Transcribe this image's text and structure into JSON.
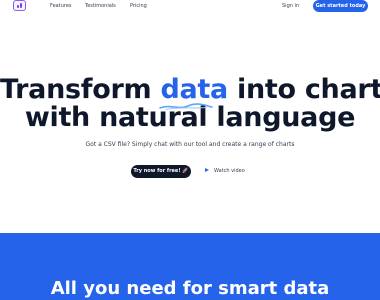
{
  "nav": {
    "logo_icon": "chart-logo-icon",
    "links": [
      "Features",
      "Testimonials",
      "Pricing"
    ],
    "signin_label": "Sign in",
    "cta_label": "Get started today"
  },
  "hero": {
    "headline_before": "Transform ",
    "headline_highlight": "data",
    "headline_after": " into charts",
    "headline_line2": "with natural language",
    "subtitle": "Got a CSV file? Simply chat with our tool and create a range of charts",
    "try_label": "Try now for free! 🚀",
    "watch_label": "Watch video",
    "watch_icon": "play-icon"
  },
  "features": {
    "title": "All you need for smart data"
  },
  "colors": {
    "accent": "#2563eb",
    "dark": "#0f172a",
    "logo": "#8b5cf6"
  }
}
